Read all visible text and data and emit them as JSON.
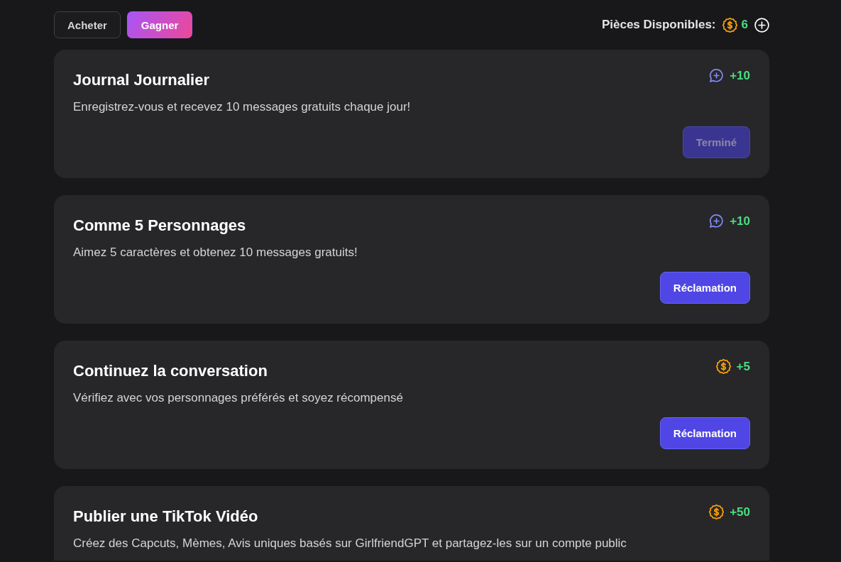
{
  "tabs": [
    {
      "label": "Acheter",
      "selected": false
    },
    {
      "label": "Gagner",
      "selected": true
    }
  ],
  "coins": {
    "label": "Pièces Disponibles:",
    "amount": "6"
  },
  "tasks": [
    {
      "title": "Journal Journalier",
      "description": "Enregistrez-vous et recevez 10 messages gratuits chaque jour!",
      "reward": {
        "kind": "messages",
        "amount": "+10"
      },
      "button": {
        "label": "Terminé",
        "disabled": true
      }
    },
    {
      "title": "Comme 5 Personnages",
      "description": "Aimez 5 caractères et obtenez 10 messages gratuits!",
      "reward": {
        "kind": "messages",
        "amount": "+10"
      },
      "button": {
        "label": "Réclamation",
        "disabled": false
      }
    },
    {
      "title": "Continuez la conversation",
      "description": "Vérifiez avec vos personnages préférés et soyez récompensé",
      "reward": {
        "kind": "coins",
        "amount": "+5"
      },
      "button": {
        "label": "Réclamation",
        "disabled": false
      }
    },
    {
      "title": "Publier une TikTok Vidéo",
      "description": "Créez des Capcuts, Mèmes, Avis uniques basés sur GirlfriendGPT et partagez-les sur un compte public",
      "reward": {
        "kind": "coins",
        "amount": "+50"
      }
    }
  ]
}
